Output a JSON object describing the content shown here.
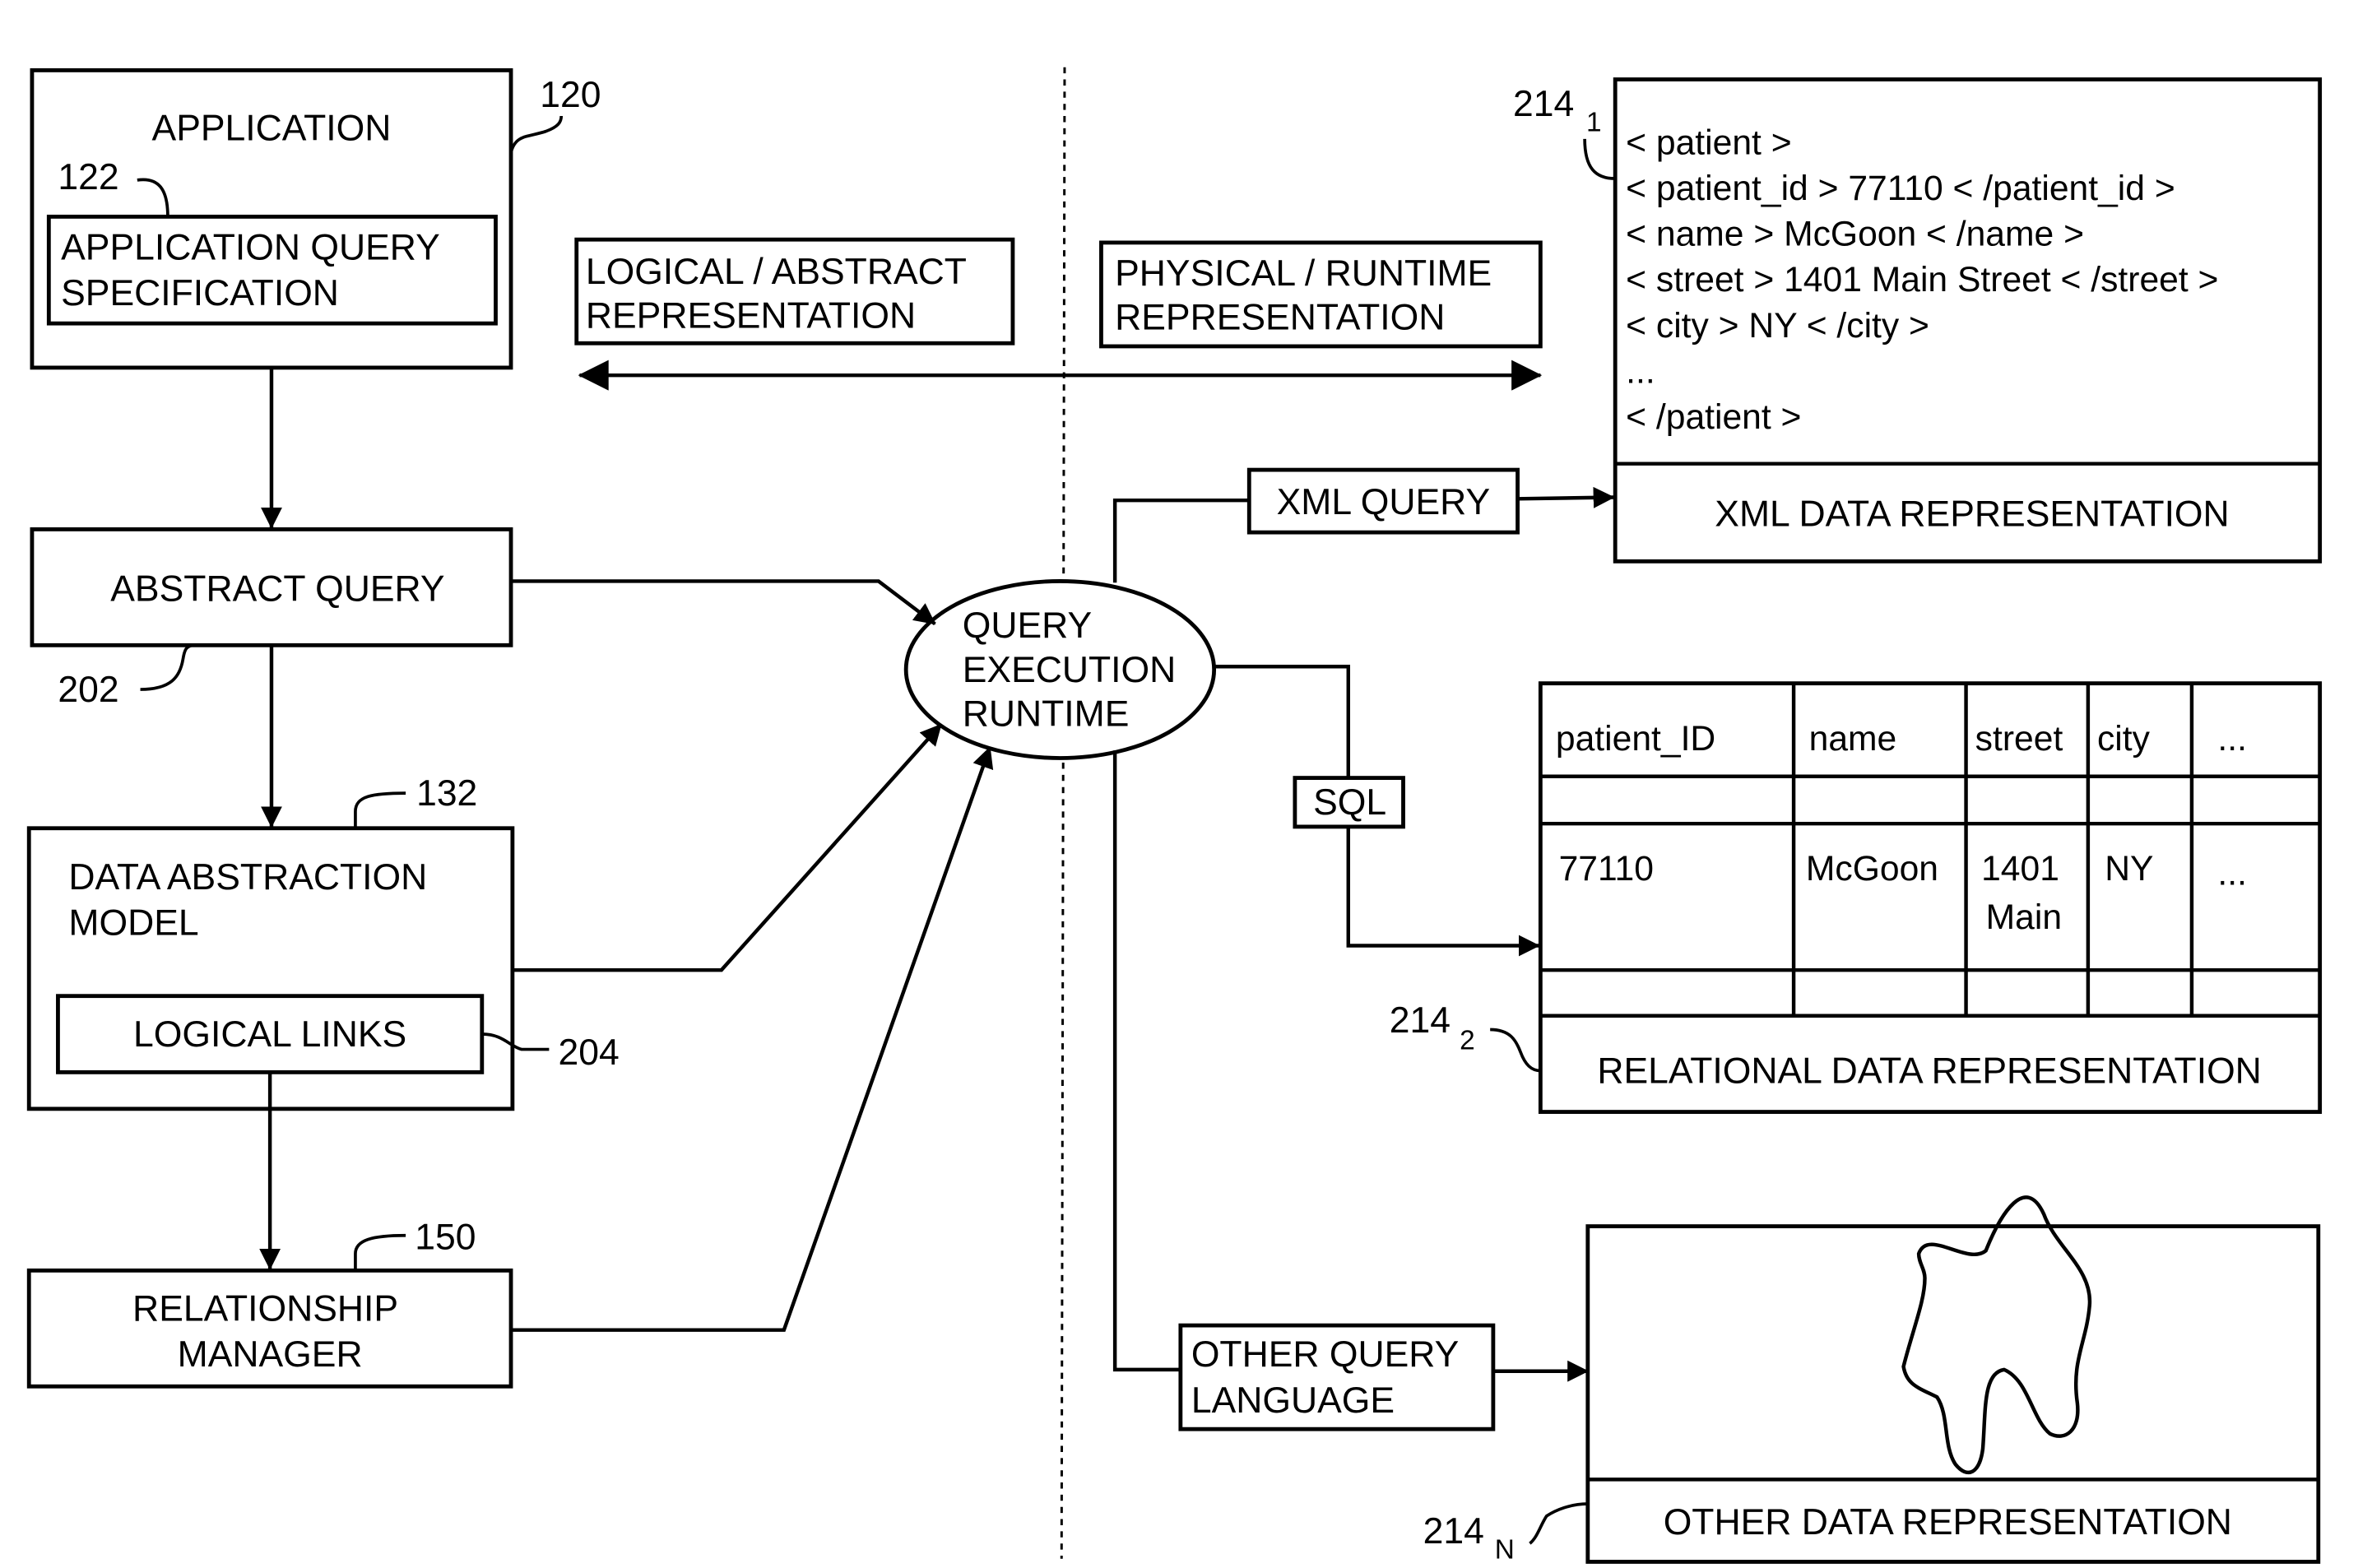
{
  "figure": {
    "divider": {
      "left_label": [
        "LOGICAL / ABSTRACT",
        "REPRESENTATION"
      ],
      "right_label": [
        "PHYSICAL / RUNTIME",
        "REPRESENTATION"
      ]
    },
    "application": {
      "title": "APPLICATION",
      "ref": "120",
      "spec": {
        "lines": [
          "APPLICATION QUERY",
          "SPECIFICATION"
        ],
        "ref": "122"
      }
    },
    "abstract_query": {
      "label": "ABSTRACT QUERY",
      "ref": "202"
    },
    "data_abstraction_model": {
      "lines": [
        "DATA ABSTRACTION",
        "MODEL"
      ],
      "ref": "132",
      "logical_links": {
        "label": "LOGICAL LINKS",
        "ref": "204"
      }
    },
    "relationship_manager": {
      "lines": [
        "RELATIONSHIP",
        "MANAGER"
      ],
      "ref": "150"
    },
    "runtime": {
      "lines": [
        "QUERY",
        "EXECUTION",
        "RUNTIME"
      ]
    },
    "queries": {
      "xml": "XML QUERY",
      "sql": "SQL",
      "other": [
        "OTHER QUERY",
        "LANGUAGE"
      ]
    },
    "xml_repr": {
      "ref": "214",
      "ref_sub": "1",
      "lines": [
        "< patient >",
        "< patient_id > 77110 < /patient_id >",
        "< name > McGoon < /name >",
        "< street > 1401 Main Street < /street >",
        "< city >  NY < /city >",
        "...",
        "< /patient >"
      ],
      "caption": "XML DATA REPRESENTATION"
    },
    "relational_repr": {
      "ref": "214",
      "ref_sub": "2",
      "columns": [
        "patient_ID",
        "name",
        "street",
        "city",
        "..."
      ],
      "row": [
        "77110",
        "McGoon",
        "1401",
        "NY",
        "..."
      ],
      "row_street_line2": "Main",
      "caption": "RELATIONAL DATA REPRESENTATION"
    },
    "other_repr": {
      "ref": "214",
      "ref_sub": "N",
      "caption": "OTHER DATA REPRESENTATION"
    }
  }
}
